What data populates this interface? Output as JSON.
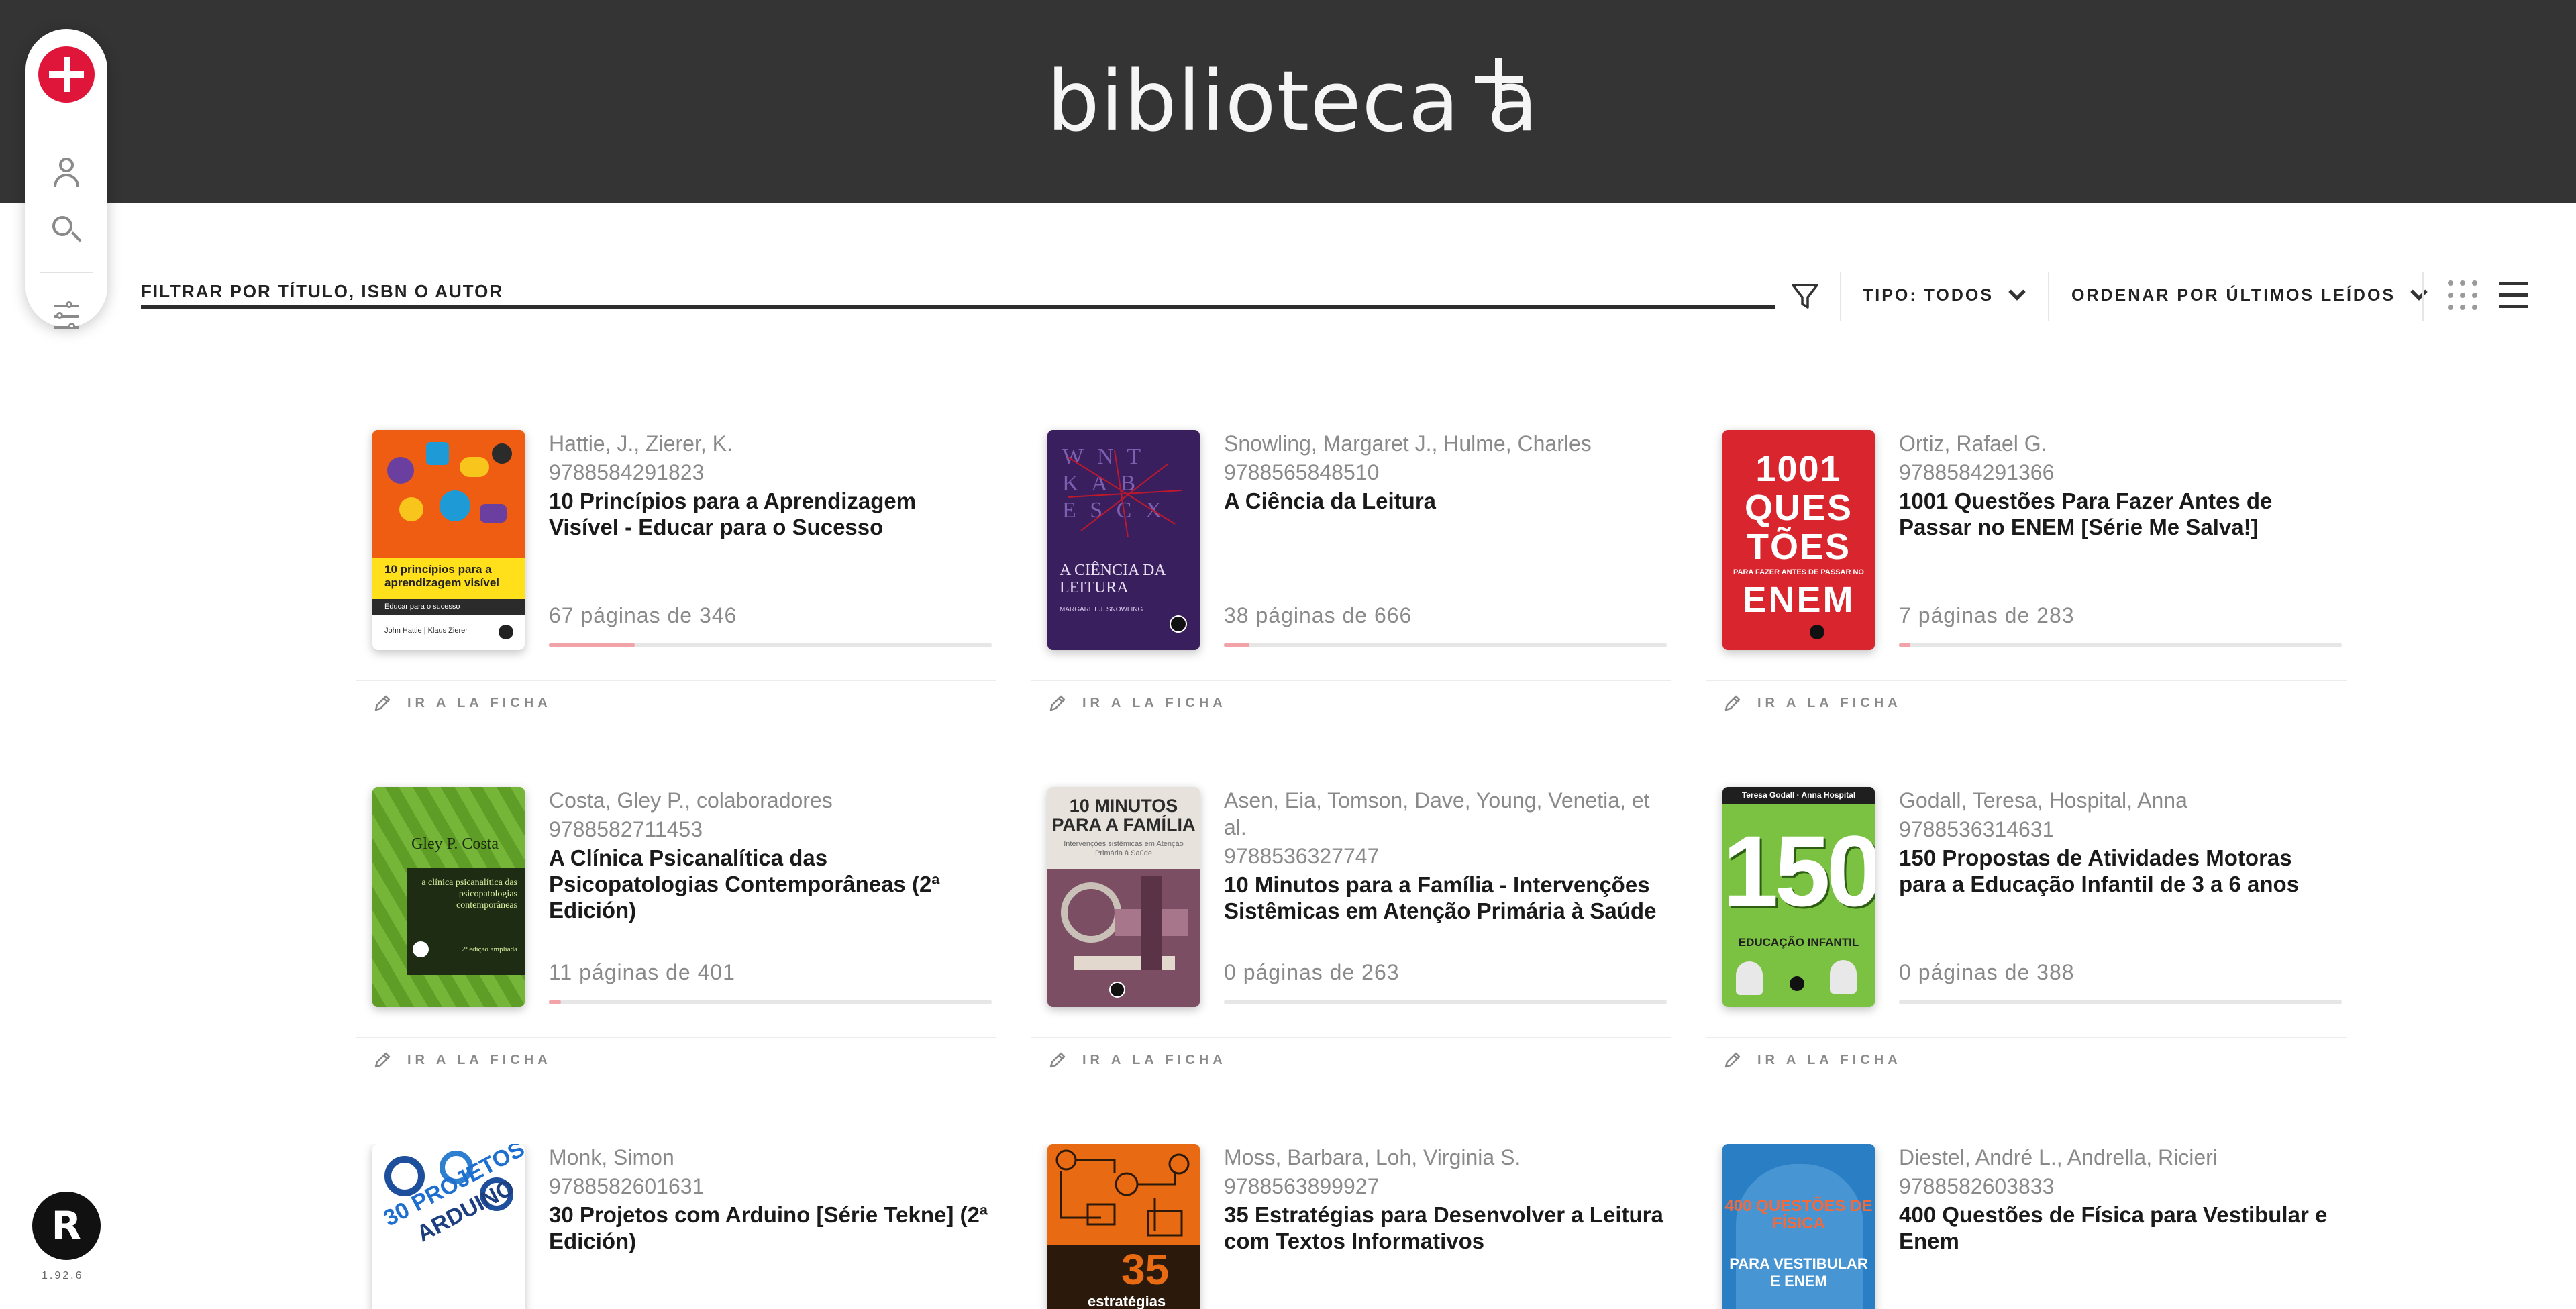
{
  "app": {
    "logo_text": "biblioteca a",
    "version": "1.92.6",
    "version_logo": "R"
  },
  "sidebar": {
    "items": [
      {
        "icon": "plus-icon",
        "label": ""
      },
      {
        "icon": "user-icon",
        "label": ""
      },
      {
        "icon": "search-icon",
        "label": ""
      },
      {
        "icon": "sliders-icon",
        "label": ""
      }
    ]
  },
  "filter": {
    "placeholder": "FILTRAR POR TÍTULO, ISBN O AUTOR",
    "type_label": "TIPO: TODOS",
    "sort_label": "ORDENAR POR ÚLTIMOS LEÍDOS"
  },
  "colors": {
    "header": "#343434",
    "brand_red": "#e0153a",
    "progress_fill": "#f2a3a8",
    "progress_track": "#e6e6e6"
  },
  "card_action_label": "IR A LA FICHA",
  "books": [
    {
      "authors": "Hattie, J., Zierer, K.",
      "isbn": "9788584291823",
      "title": "10 Princípios para a Aprendizagem Visível - Educar para o Sucesso",
      "pages_text": "67 páginas de 346",
      "progress": 0.194,
      "cover": {
        "title": "10 princípios para a aprendizagem visível",
        "subtitle": "Educar para o sucesso",
        "authors": "John Hattie | Klaus Zierer"
      }
    },
    {
      "authors": "Snowling, Margaret J., Hulme, Charles",
      "isbn": "9788565848510",
      "title": "A Ciência da Leitura",
      "pages_text": "38 páginas de 666",
      "progress": 0.057,
      "cover": {
        "title": "A CIÊNCIA DA LEITURA",
        "authors": "MARGARET J. SNOWLING"
      }
    },
    {
      "authors": "Ortiz, Rafael G.",
      "isbn": "9788584291366",
      "title": "1001 Questões Para Fazer Antes de Passar no ENEM [Série Me Salva!]",
      "pages_text": "7 páginas de 283",
      "progress": 0.025,
      "cover": {
        "line1": "1001",
        "line2": "QUES",
        "line3": "TÕES",
        "tagline": "PARA FAZER ANTES DE PASSAR NO",
        "exam": "ENEM"
      }
    },
    {
      "authors": "Costa, Gley P., colaboradores",
      "isbn": "9788582711453",
      "title": "A Clínica Psicanalítica das Psicopatologias Contemporâneas (2ª Edición)",
      "pages_text": "11 páginas de 401",
      "progress": 0.027,
      "cover": {
        "author": "Gley P. Costa",
        "title": "a clínica psicanalítica das psicopatologias contemporâneas",
        "edition": "2ª edição ampliada"
      }
    },
    {
      "authors": "Asen, Eia, Tomson, Dave, Young, Venetia, et al.",
      "isbn": "9788536327747",
      "title": "10 Minutos para a Família - Intervenções Sistêmicas em Atenção Primária à Saúde",
      "pages_text": "0 páginas de 263",
      "progress": 0,
      "cover": {
        "title": "10 MINUTOS PARA A FAMÍLIA",
        "subtitle": "Intervenções sistêmicas em Atenção Primária à Saúde"
      }
    },
    {
      "authors": "Godall, Teresa, Hospital, Anna",
      "isbn": "9788536314631",
      "title": "150 Propostas de Atividades Motoras para a Educação Infantil de 3 a 6 anos",
      "pages_text": "0 páginas de 388",
      "progress": 0,
      "cover": {
        "authors": "Teresa Godall · Anna Hospital",
        "number": "150",
        "title": "EDUCAÇÃO INFANTIL"
      }
    },
    {
      "authors": "Monk, Simon",
      "isbn": "9788582601631",
      "title": "30 Projetos com Arduino [Série Tekne] (2ª Edición)",
      "pages_text": "",
      "progress": null,
      "cover": {
        "title": "30 PROJETOS",
        "subtitle": "ARDUINO"
      }
    },
    {
      "authors": "Moss, Barbara, Loh, Virginia S.",
      "isbn": "9788563899927",
      "title": "35 Estratégias para Desenvolver a Leitura com Textos Informativos",
      "pages_text": "",
      "progress": null,
      "cover": {
        "number": "35",
        "title": "estratégias"
      }
    },
    {
      "authors": "Diestel, André L., Andrella, Ricieri",
      "isbn": "9788582603833",
      "title": "400 Questões de Física para Vestibular e Enem",
      "pages_text": "",
      "progress": null,
      "cover": {
        "title": "400 QUESTÕES DE FÍSICA",
        "subtitle": "PARA VESTIBULAR E ENEM"
      }
    }
  ]
}
